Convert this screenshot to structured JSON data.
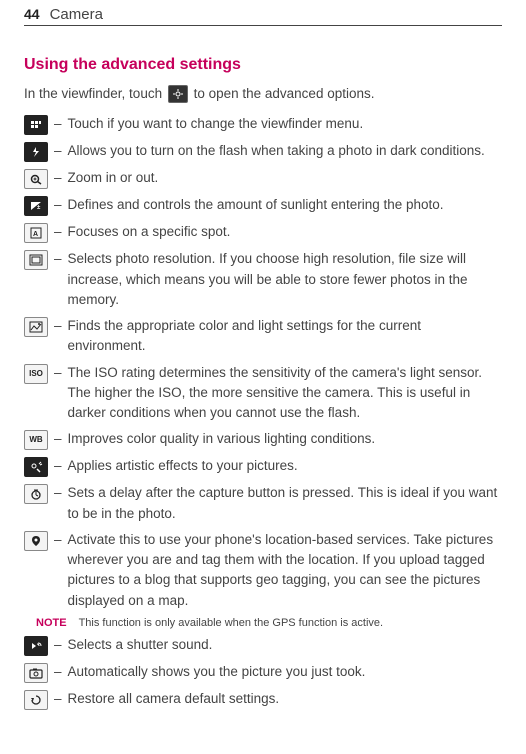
{
  "header": {
    "page_number": "44",
    "chapter": "Camera"
  },
  "section_title": "Using the advanced settings",
  "intro_before": "In the viewfinder, touch ",
  "intro_after": " to open the advanced options.",
  "gear_icon_name": "gear-icon",
  "rows": [
    {
      "icon": "grid",
      "text": "Touch if you want to change the viewfinder menu."
    },
    {
      "icon": "flash",
      "text": "Allows you to turn on the flash when taking a photo in dark conditions."
    },
    {
      "icon": "zoom",
      "text": "Zoom in or out."
    },
    {
      "icon": "exposure",
      "text": "Defines and controls the amount of sunlight entering the photo."
    },
    {
      "icon": "focus",
      "text": "Focuses on a specific spot."
    },
    {
      "icon": "resolution",
      "text": "Selects photo resolution. If you choose high resolution, file size will increase, which means you will be able to store fewer photos in the memory."
    },
    {
      "icon": "scene",
      "text": "Finds the appropriate color and light settings for the current environment."
    },
    {
      "icon": "iso",
      "text": "The ISO rating determines the sensitivity of the camera's light sensor. The higher the ISO, the more sensitive the camera. This is useful in darker conditions when you cannot use the flash."
    },
    {
      "icon": "wb",
      "text": "Improves color quality in various lighting conditions."
    },
    {
      "icon": "effects",
      "text": "Applies artistic effects to your pictures."
    },
    {
      "icon": "timer",
      "text": "Sets a delay after the capture button is pressed. This is ideal if you want to be in the photo."
    },
    {
      "icon": "geo",
      "text": "Activate this to use your phone's location-based services. Take pictures wherever you are and tag them with the location. If you upload tagged pictures to a blog that supports geo tagging, you can see the pictures displayed on a map."
    }
  ],
  "note": {
    "label": "NOTE",
    "text": "This function is only available when the GPS function is active."
  },
  "rows_after": [
    {
      "icon": "shutter",
      "text": "Selects a shutter sound."
    },
    {
      "icon": "review",
      "text": "Automatically shows you the picture you just took."
    },
    {
      "icon": "reset",
      "text": "Restore all camera default settings."
    }
  ]
}
